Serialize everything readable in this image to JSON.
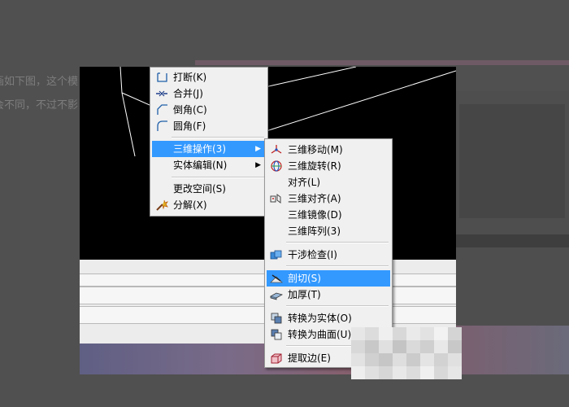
{
  "background": {
    "line1": "画如下图，这个模",
    "line2": "会不同，不过不影"
  },
  "context_menu": {
    "items": [
      {
        "label": "打断(K)",
        "icon": "break-icon"
      },
      {
        "label": "合并(J)",
        "icon": "join-icon"
      },
      {
        "label": "倒角(C)",
        "icon": "chamfer-icon"
      },
      {
        "label": "圆角(F)",
        "icon": "fillet-icon"
      },
      {
        "label": "三维操作(3)",
        "icon": "",
        "submenu": true,
        "highlighted": true
      },
      {
        "label": "实体编辑(N)",
        "icon": "",
        "submenu": true
      },
      {
        "label": "更改空间(S)",
        "icon": ""
      },
      {
        "label": "分解(X)",
        "icon": "explode-icon"
      }
    ]
  },
  "submenu_3d": {
    "items": [
      {
        "label": "三维移动(M)",
        "icon": "3d-move-icon"
      },
      {
        "label": "三维旋转(R)",
        "icon": "3d-rotate-icon"
      },
      {
        "label": "对齐(L)",
        "icon": ""
      },
      {
        "label": "三维对齐(A)",
        "icon": "3d-align-icon"
      },
      {
        "label": "三维镜像(D)",
        "icon": ""
      },
      {
        "label": "三维阵列(3)",
        "icon": ""
      },
      {
        "label": "干涉检查(I)",
        "icon": "interference-check-icon"
      },
      {
        "label": "剖切(S)",
        "icon": "slice-icon",
        "highlighted": true
      },
      {
        "label": "加厚(T)",
        "icon": "thicken-icon"
      },
      {
        "label": "转换为实体(O)",
        "icon": "convert-to-solid-icon"
      },
      {
        "label": "转换为曲面(U)",
        "icon": "convert-to-surface-icon"
      },
      {
        "label": "提取边(E)",
        "icon": "extract-edges-icon"
      }
    ]
  },
  "colors": {
    "highlight": "#3399ff",
    "menu_bg": "#f0f0f0",
    "viewport": "#000000"
  }
}
